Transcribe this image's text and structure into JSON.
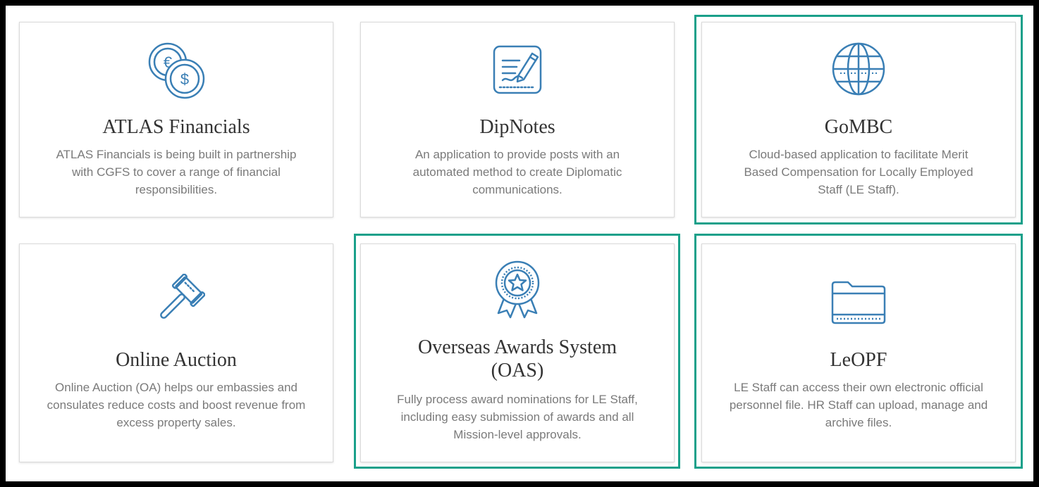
{
  "highlight_color": "#1aa08a",
  "icon_color": "#3a7fb5",
  "cards": [
    {
      "title": "ATLAS Financials",
      "description": "ATLAS Financials is being built in partnership with CGFS to cover a range of financial responsibilities.",
      "icon": "currency-coins-icon",
      "euro_symbol": "€",
      "dollar_symbol": "$",
      "highlighted": false
    },
    {
      "title": "DipNotes",
      "description": "An application to provide posts with an automated method to create Diplomatic communications.",
      "icon": "notepad-pencil-icon",
      "highlighted": false
    },
    {
      "title": "GoMBC",
      "description": "Cloud-based application to facilitate Merit Based Compensation for Locally Employed Staff (LE Staff).",
      "icon": "globe-icon",
      "highlighted": true
    },
    {
      "title": "Online Auction",
      "description": "Online Auction (OA) helps our embassies and consulates reduce costs and boost revenue from excess property sales.",
      "icon": "gavel-icon",
      "highlighted": false
    },
    {
      "title": "Overseas Awards System (OAS)",
      "description": "Fully process award nominations for LE Staff, including easy submission of awards and all Mission-level approvals.",
      "icon": "award-ribbon-icon",
      "highlighted": true
    },
    {
      "title": "LeOPF",
      "description": "LE Staff can access their own electronic official personnel file. HR Staff can upload, manage and archive files.",
      "icon": "folder-icon",
      "highlighted": true
    }
  ]
}
